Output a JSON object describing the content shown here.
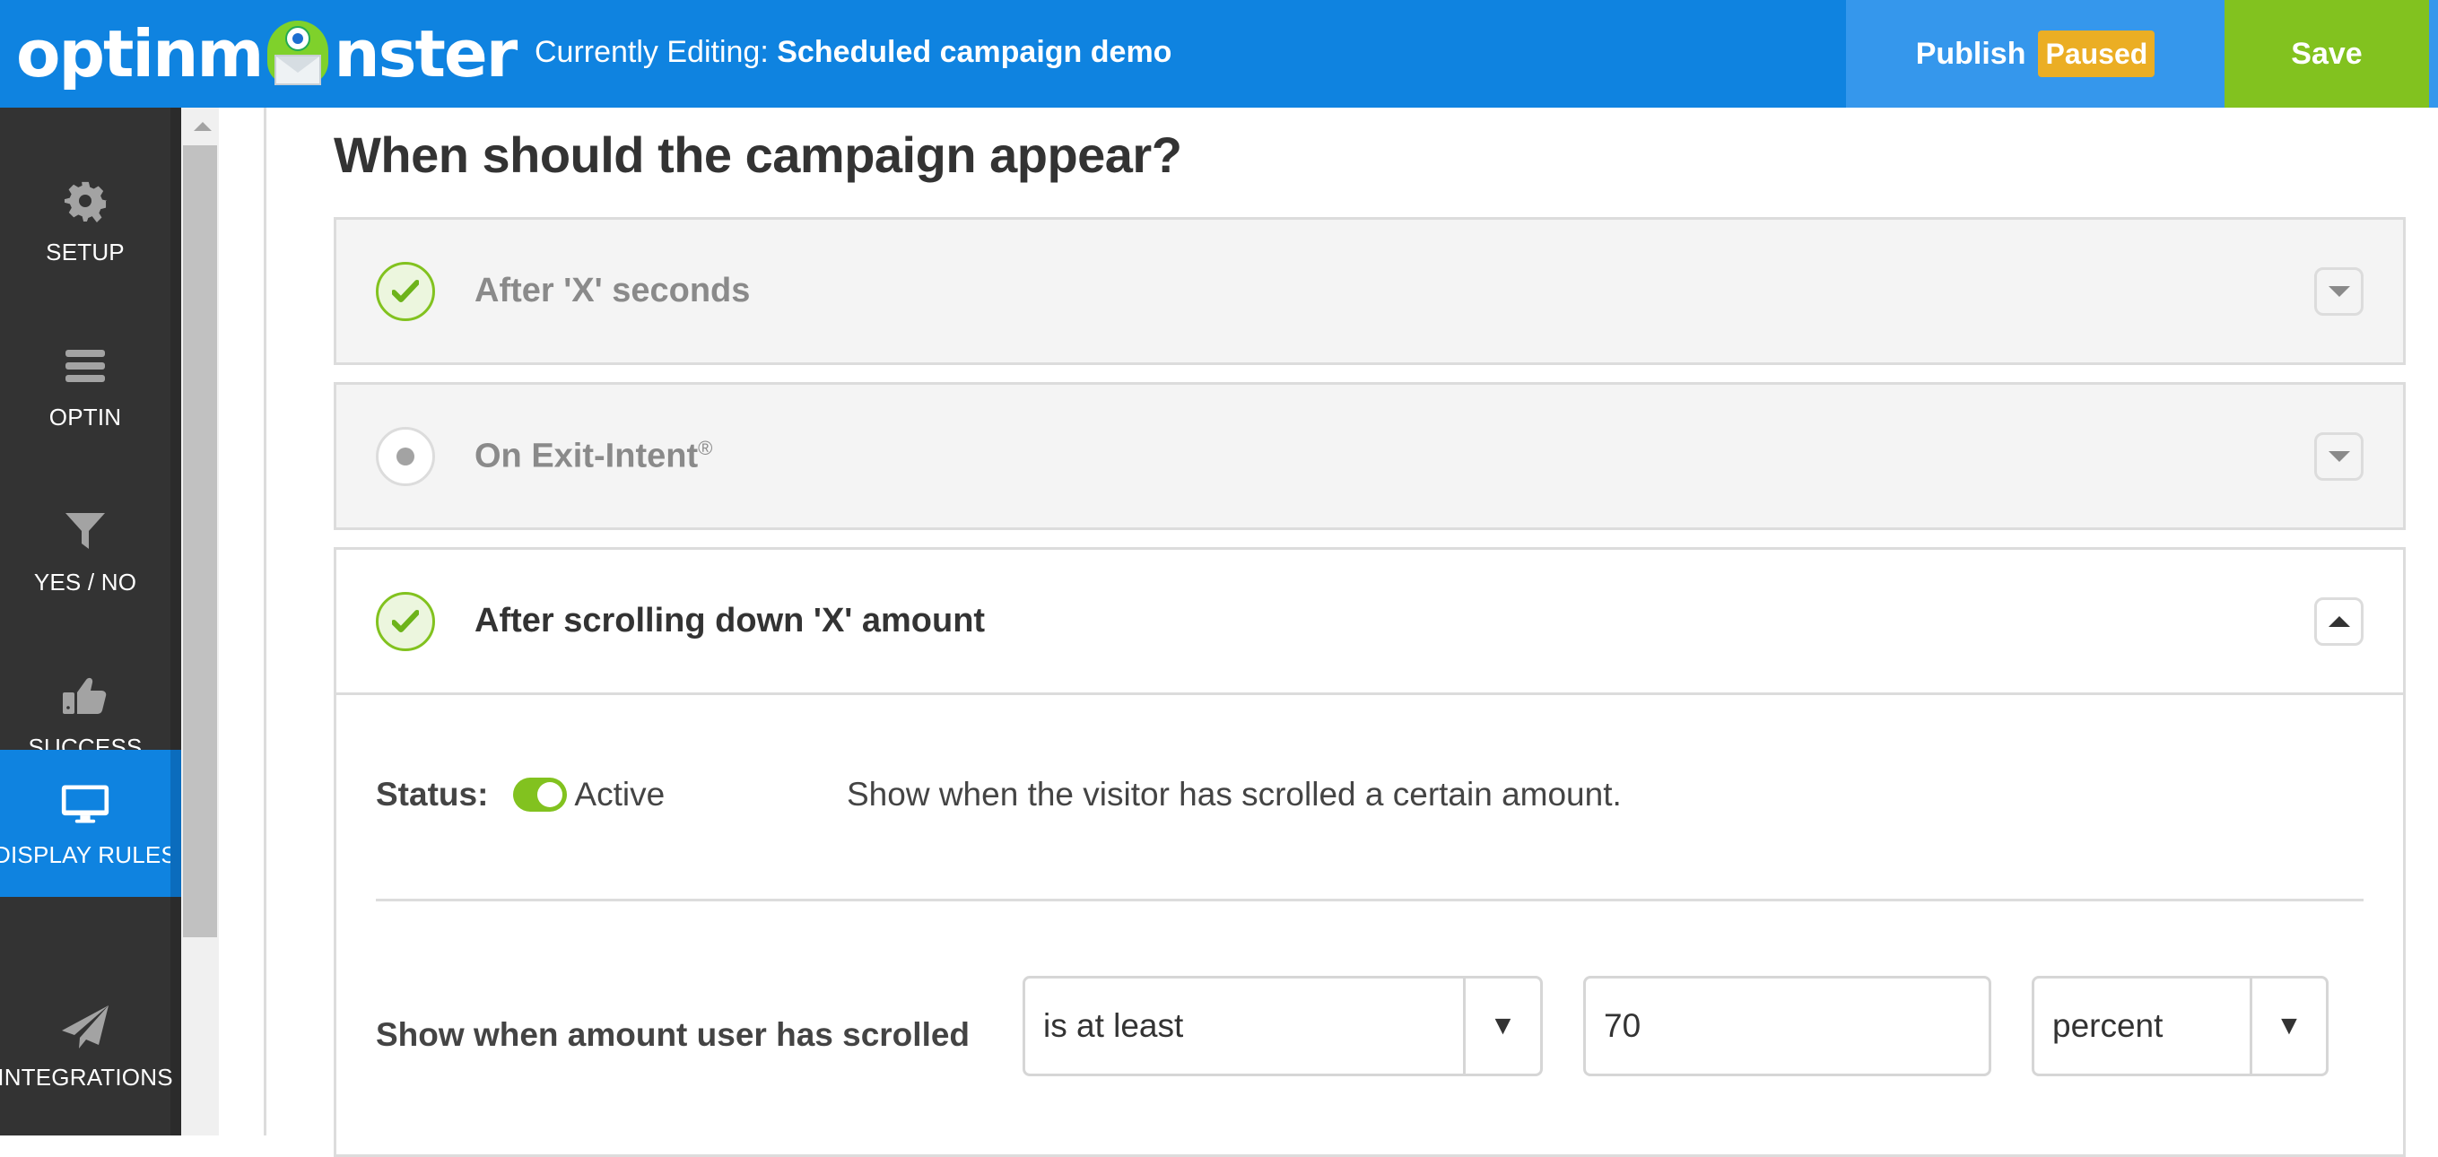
{
  "header": {
    "logo_text_left": "optinm",
    "logo_text_right": "nster",
    "editing_prefix": "Currently Editing:",
    "campaign_name": "Scheduled campaign demo",
    "publish_label": "Publish",
    "publish_status": "Paused",
    "save_label": "Save"
  },
  "sidebar": {
    "items": [
      {
        "label": "SETUP",
        "icon": "gear-icon",
        "active": false
      },
      {
        "label": "OPTIN",
        "icon": "hamburger-icon",
        "active": false
      },
      {
        "label": "YES / NO",
        "icon": "filter-icon",
        "active": false
      },
      {
        "label": "SUCCESS",
        "icon": "thumbs-up-icon",
        "active": false
      },
      {
        "label": "DISPLAY RULES",
        "icon": "monitor-icon",
        "active": true
      },
      {
        "label": "INTEGRATIONS",
        "icon": "paper-plane-icon",
        "active": false
      }
    ]
  },
  "main": {
    "title": "When should the campaign appear?",
    "rules": [
      {
        "label": "After 'X' seconds",
        "state": "checked",
        "expanded": false
      },
      {
        "label": "On Exit-Intent",
        "trademark": "®",
        "state": "unchecked",
        "expanded": false
      },
      {
        "label": "After scrolling down 'X' amount",
        "state": "checked",
        "expanded": true
      }
    ],
    "scroll_rule": {
      "status_label": "Status:",
      "status_value": "Active",
      "status_on": true,
      "description": "Show when the visitor has scrolled a certain amount.",
      "amount_label": "Show when amount user has scrolled",
      "comparator": "is at least",
      "amount": "70",
      "unit": "percent",
      "dropdown_arrow": "▼"
    }
  },
  "colors": {
    "brand_blue": "#0f83e0",
    "publish_blue": "#3597ec",
    "save_green": "#82c21f",
    "paused_badge": "#ebae24",
    "sidebar_dark": "#333333"
  }
}
